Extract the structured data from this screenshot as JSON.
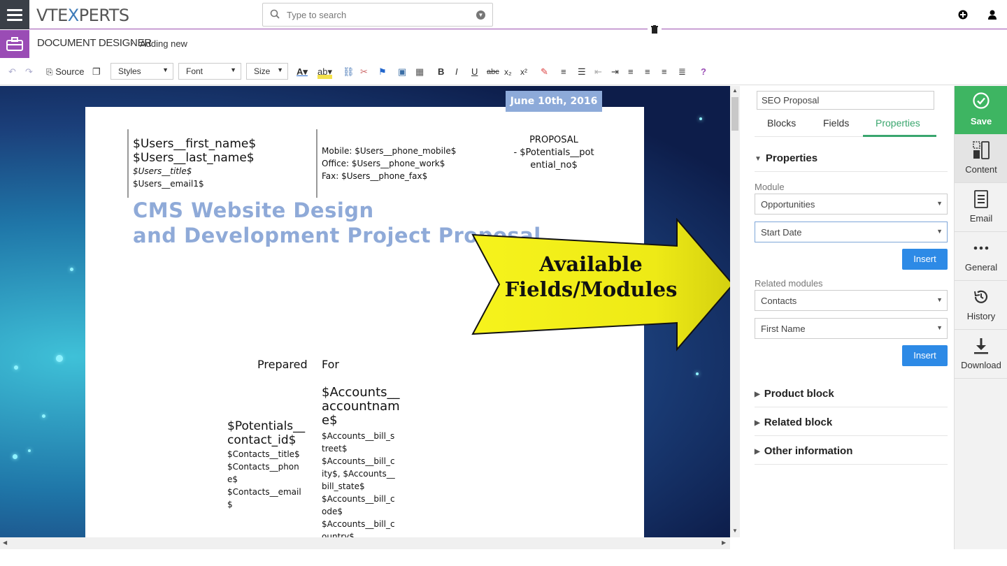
{
  "topbar": {
    "logo_prefix": "VTE",
    "logo_mid": "X",
    "logo_suffix": "PERTS",
    "search_placeholder": "Type to search"
  },
  "breadcrumb": {
    "title": "DOCUMENT DESIGNER",
    "separator": "›",
    "current": "Adding new"
  },
  "toolbar": {
    "source_label": "Source",
    "styles_label": "Styles",
    "font_label": "Font",
    "size_label": "Size"
  },
  "document": {
    "user_first_name": "$Users__first_name$",
    "user_last_name": "$Users__last_name$",
    "user_title": "$Users__title$",
    "user_email": "$Users__email1$",
    "phone_mobile": "Mobile: $Users__phone_mobile$",
    "phone_work": "Office: $Users__phone_work$",
    "phone_fax": "Fax: $Users__phone_fax$",
    "proposal_line1": "PROPOSAL",
    "proposal_line2": "- $Potentials__pot",
    "proposal_line3": "ential_no$",
    "date": "June 10th, 2016",
    "title_line1": "CMS Website Design",
    "title_line2": "and Development Project Proposal",
    "prepared": "Prepared",
    "for": "For",
    "account_name_l1": "$Accounts__",
    "account_name_l2": "accountnam",
    "account_name_l3": "e$",
    "contact_id_l1": "$Potentials__",
    "contact_id_l2": "contact_id$",
    "contact_lines": [
      "$Contacts__title$",
      "$Contacts__phon",
      "e$",
      "$Contacts__email",
      "$"
    ],
    "account_lines": [
      "$Accounts__bill_s",
      "treet$",
      "$Accounts__bill_c",
      "ity$, $Accounts__",
      "bill_state$",
      "$Accounts__bill_c",
      "ode$",
      "$Accounts__bill_c",
      "ountry$"
    ]
  },
  "callout": {
    "line1": "Available",
    "line2": "Fields/Modules",
    "color": "#f5f21a"
  },
  "panel": {
    "template_name": "SEO Proposal",
    "tabs": [
      "Blocks",
      "Fields",
      "Properties"
    ],
    "active_tab": "Properties",
    "properties_heading": "Properties",
    "module_label": "Module",
    "module_value": "Opportunities",
    "field_value": "Start Date",
    "insert_label": "Insert",
    "related_label": "Related modules",
    "related_value": "Contacts",
    "related_field_value": "First Name",
    "insert2_label": "Insert",
    "sections": [
      "Product block",
      "Related block",
      "Other information"
    ]
  },
  "sidebar": {
    "save": "Save",
    "items": [
      "Content",
      "Email",
      "General",
      "History",
      "Download"
    ]
  },
  "colors": {
    "accent_purple": "#9a4cb5",
    "save_green": "#3eb562",
    "insert_blue": "#2d8ae6",
    "tab_green": "#3aa66e"
  }
}
